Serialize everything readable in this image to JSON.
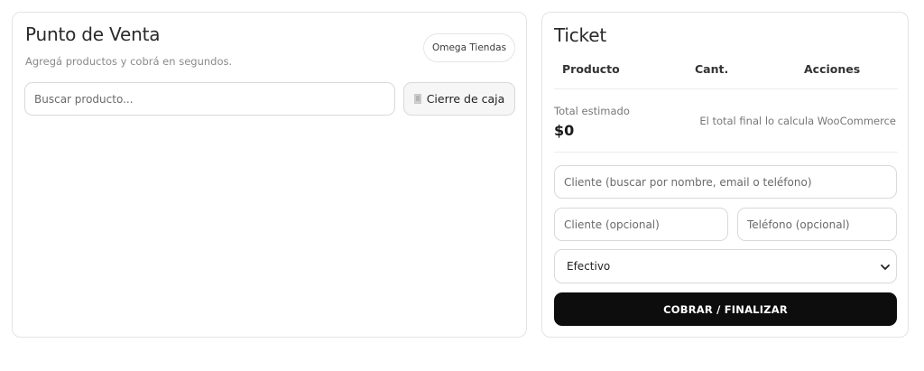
{
  "pos": {
    "title": "Punto de Venta",
    "subtitle": "Agregá productos y cobrá en segundos.",
    "store_name": "Omega Tiendas",
    "search_placeholder": "Buscar producto...",
    "close_register_label": "Cierre de caja"
  },
  "ticket": {
    "title": "Ticket",
    "columns": [
      "Producto",
      "Cant.",
      "Acciones"
    ],
    "total_label": "Total estimado",
    "total_value": "$0",
    "total_note": "El total final lo calcula WooCommerce",
    "client_search_placeholder": "Cliente (buscar por nombre, email o teléfono)",
    "client_name_placeholder": "Cliente (opcional)",
    "phone_placeholder": "Teléfono (opcional)",
    "payment_method": "Efectivo",
    "submit_label": "COBRAR / FINALIZAR"
  },
  "colors": {
    "primary_button": "#0d0d0d",
    "border": "#d9d9d9",
    "muted_text": "#777777"
  },
  "icons": {
    "close_register": "receipt-icon",
    "select_arrow": "chevron-down-icon"
  }
}
